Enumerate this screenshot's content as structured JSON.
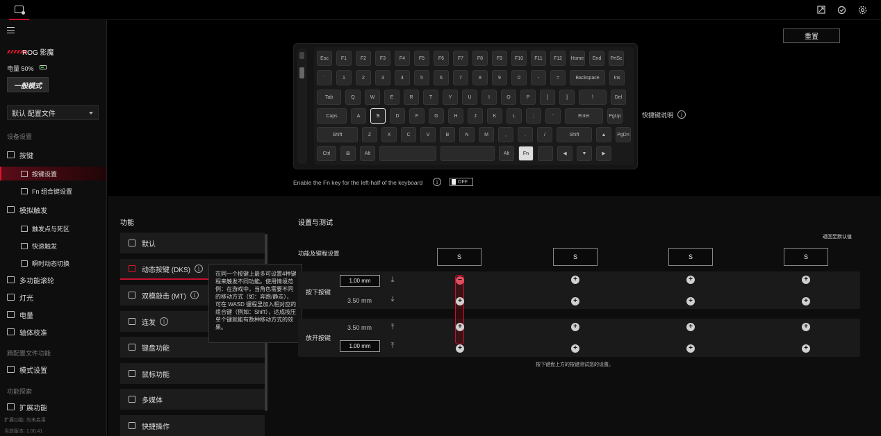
{
  "header": {
    "tab_icon": "device-tab-icon",
    "right_icons": [
      "shortcut-icon",
      "update-icon",
      "settings-icon"
    ]
  },
  "sidebar": {
    "device_name": "ROG 影魔",
    "battery": "电量 50%",
    "battery_level": 0.5,
    "mode": "一般模式",
    "profile": "默认 配置文件",
    "sections": {
      "device": "设备设置",
      "profile_fn": "跨配置文件功能",
      "explore": "功能探索"
    },
    "items": {
      "keys": "按键",
      "key_settings": "按键设置",
      "fn_combo": "Fn 组合键设置",
      "analog": "模拟触发",
      "trigger_dead": "触发点与死区",
      "rapid": "快速触发",
      "snap": "瞬时动态切换",
      "wheel": "多功能滚轮",
      "light": "灯光",
      "power": "电量",
      "calib": "轴体校准",
      "mode_settings": "模式设置",
      "ext": "扩展功能"
    },
    "footer": {
      "ext_status": "扩展功能: 尚未启用",
      "version": "当前版本: 1.00.41"
    }
  },
  "keyboard": {
    "rows": [
      [
        "Esc",
        "F1",
        "F2",
        "F3",
        "F4",
        "F5",
        "F6",
        "F7",
        "F8",
        "F9",
        "F10",
        "F11",
        "F12",
        "Home",
        "End",
        "PrtSc"
      ],
      [
        "`",
        "1",
        "2",
        "3",
        "4",
        "5",
        "6",
        "7",
        "8",
        "9",
        "0",
        "-",
        "=",
        "Backspace",
        "Ins"
      ],
      [
        "Tab",
        "Q",
        "W",
        "E",
        "R",
        "T",
        "Y",
        "U",
        "I",
        "O",
        "P",
        "[",
        "]",
        "\\",
        "Del"
      ],
      [
        "Caps",
        "A",
        "S",
        "D",
        "F",
        "G",
        "H",
        "J",
        "K",
        "L",
        ";",
        "'",
        "Enter",
        "PgUp"
      ],
      [
        "Shift",
        "Z",
        "X",
        "C",
        "V",
        "B",
        "N",
        "M",
        ",",
        ".",
        "/",
        "Shift",
        "▲",
        "PgDn"
      ],
      [
        "Ctrl",
        "⊞",
        "Alt",
        "",
        "",
        "Alt",
        "Fn",
        "",
        "◀",
        "▼",
        "▶"
      ]
    ],
    "selected_key": "S"
  },
  "reset_label": "重置",
  "shortcut_help": "快捷键说明",
  "fn_toggle": {
    "label": "Enable the Fn key for the left-half of the keyboard",
    "state": "OFF"
  },
  "functions": {
    "title": "功能",
    "items": [
      "默认",
      "动态按键 (DKS)",
      "双模敲击 (MT)",
      "连发",
      "键盘功能",
      "鼠标功能",
      "多媒体",
      "快捷操作"
    ]
  },
  "tooltip": "在同一个按键上最多可设置4种键程来触发不同功能。使用情境范例：在游戏中，当角色需要不同的移动方式（如：奔跑/静走），可在 WASD 键程里加入相对应的组合键（例如：Shift），达成按压单个键就能有数种移动方式的效果。",
  "settings": {
    "title": "设置与测试",
    "return_default": "返回至默认值",
    "fks_label": "功能及键程设置",
    "slots": [
      "S",
      "S",
      "S",
      "S"
    ],
    "press": {
      "label": "按下按键",
      "val1": "1.00 mm",
      "val2": "3.50 mm"
    },
    "release": {
      "label": "放开按键",
      "val1": "3.50 mm",
      "val2": "1.00 mm"
    },
    "note": "按下键盘上方的按键测试您的设置。"
  }
}
